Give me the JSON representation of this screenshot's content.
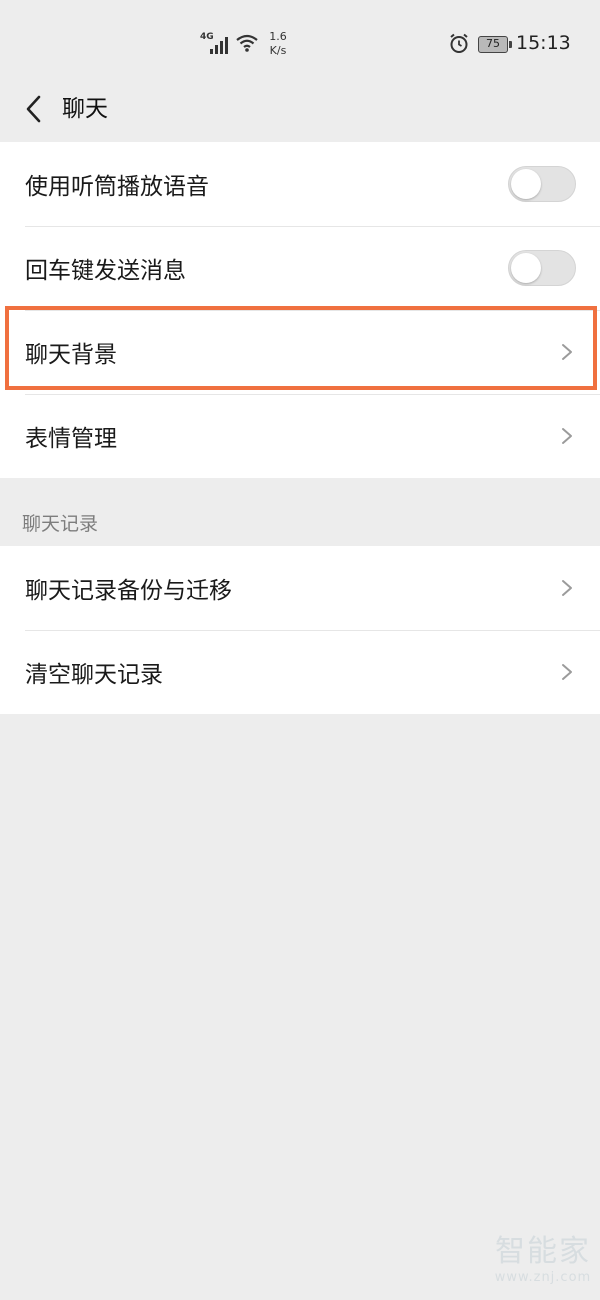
{
  "status_bar": {
    "network": "4G",
    "speed_value": "1.6",
    "speed_unit": "K/s",
    "battery": "75",
    "time": "15:13"
  },
  "header": {
    "title": "聊天"
  },
  "chat_settings": {
    "items": [
      {
        "label": "使用听筒播放语音",
        "type": "toggle",
        "on": false
      },
      {
        "label": "回车键发送消息",
        "type": "toggle",
        "on": false
      },
      {
        "label": "聊天背景",
        "type": "link",
        "highlighted": true
      },
      {
        "label": "表情管理",
        "type": "link"
      }
    ]
  },
  "chat_history_section": {
    "title": "聊天记录",
    "items": [
      {
        "label": "聊天记录备份与迁移",
        "type": "link"
      },
      {
        "label": "清空聊天记录",
        "type": "link"
      }
    ]
  },
  "watermark": {
    "main": "智能家",
    "sub": "www.znj.com"
  },
  "colors": {
    "background": "#ededed",
    "card": "#ffffff",
    "highlight": "#f0703f",
    "toggle_off": "#e3e3e3"
  }
}
